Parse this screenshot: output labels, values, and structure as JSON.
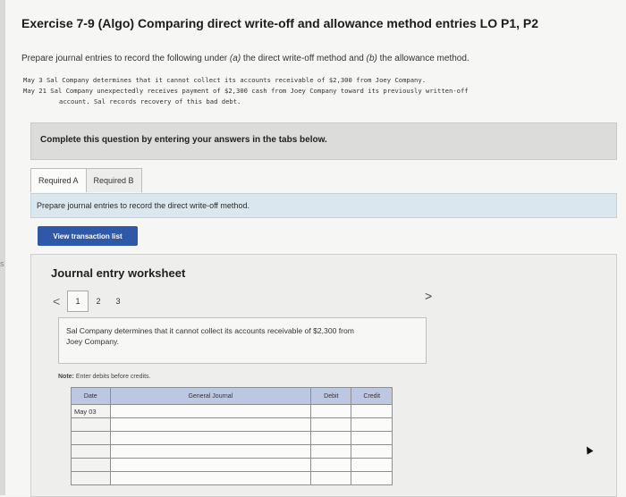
{
  "title": "Exercise 7-9 (Algo) Comparing direct write-off and allowance method entries LO P1, P2",
  "instruction": {
    "part1": "Prepare journal entries to record the following under ",
    "a": "(a)",
    "part2": " the direct write-off method and ",
    "b": "(b)",
    "part3": " the allowance method."
  },
  "events": {
    "line1": "May 3 Sal Company determines that it cannot collect its accounts receivable of $2,300 from Joey Company.",
    "line2": "May 21 Sal Company unexpectedly receives payment of $2,300 cash from Joey Company toward its previously written-off",
    "line3": "account. Sal records recovery of this bad debt."
  },
  "complete_text": "Complete this question by entering your answers in the tabs below.",
  "tabs": [
    "Required A",
    "Required B"
  ],
  "required_text": "Prepare journal entries to record the direct write-off method.",
  "view_transaction_button": "View transaction list",
  "worksheet": {
    "title": "Journal entry worksheet",
    "pages": [
      "1",
      "2",
      "3"
    ],
    "prev_arrow": "<",
    "next_arrow": ">",
    "description": "Sal Company determines that it cannot collect its accounts receivable of $2,300 from Joey Company.",
    "note_label": "Note:",
    "note_text": " Enter debits before credits.",
    "table": {
      "headers": [
        "Date",
        "General Journal",
        "Debit",
        "Credit"
      ],
      "date_value": "May 03"
    }
  },
  "left_mark": "s"
}
